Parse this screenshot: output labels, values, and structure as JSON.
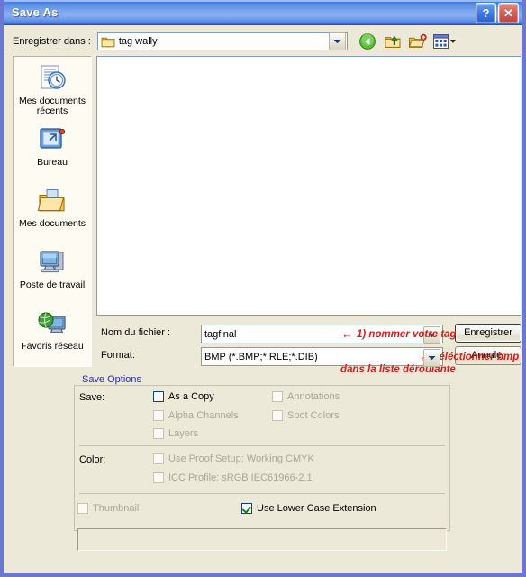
{
  "window": {
    "title": "Save As",
    "help_button": "?",
    "close_button": "✕"
  },
  "toolbar": {
    "lookin_label": "Enregistrer dans :",
    "current_folder": "tag wally",
    "icons": [
      {
        "name": "back-icon",
        "tooltip": "Précédent"
      },
      {
        "name": "up-folder-icon",
        "tooltip": "Dossier parent"
      },
      {
        "name": "new-folder-icon",
        "tooltip": "Nouveau dossier"
      },
      {
        "name": "views-icon",
        "tooltip": "Affichages"
      }
    ]
  },
  "places_bar": {
    "items": [
      {
        "label": "Mes documents récents",
        "icon": "recent-documents-icon"
      },
      {
        "label": "Bureau",
        "icon": "desktop-icon"
      },
      {
        "label": "Mes documents",
        "icon": "my-documents-icon"
      },
      {
        "label": "Poste de travail",
        "icon": "my-computer-icon"
      },
      {
        "label": "Favoris réseau",
        "icon": "network-places-icon"
      }
    ]
  },
  "file_list": {
    "items": []
  },
  "fields": {
    "filename_label": "Nom du fichier :",
    "filename_value": "tagfinal",
    "format_label": "Format:",
    "format_value": "BMP (*.BMP;*.RLE;*.DIB)"
  },
  "annotations": {
    "arrow_glyph": "←",
    "filename_note": "1) nommer votre tag",
    "format_note": "séléctionner bmp",
    "format_note_line2": "dans la liste déroulante",
    "color": "#d21e1e"
  },
  "buttons": {
    "save": "Enregistrer",
    "cancel": "Annuler"
  },
  "save_options": {
    "legend": "Save Options",
    "save_label": "Save:",
    "color_label": "Color:",
    "checkboxes": {
      "as_a_copy": {
        "label": "As a Copy",
        "checked": false,
        "enabled": true
      },
      "alpha_channels": {
        "label": "Alpha Channels",
        "checked": false,
        "enabled": false
      },
      "layers": {
        "label": "Layers",
        "checked": false,
        "enabled": false
      },
      "annotations": {
        "label": "Annotations",
        "checked": false,
        "enabled": false
      },
      "spot_colors": {
        "label": "Spot Colors",
        "checked": false,
        "enabled": false
      },
      "use_proof_setup": {
        "label": "Use Proof Setup:  Working CMYK",
        "checked": false,
        "enabled": false
      },
      "icc_profile": {
        "label": "ICC Profile:  sRGB IEC61966-2.1",
        "checked": false,
        "enabled": false
      },
      "thumbnail": {
        "label": "Thumbnail",
        "checked": false,
        "enabled": false
      },
      "lower_case_extension": {
        "label": "Use Lower Case Extension",
        "checked": true,
        "enabled": true
      }
    }
  },
  "bottom_field": {
    "value": ""
  }
}
